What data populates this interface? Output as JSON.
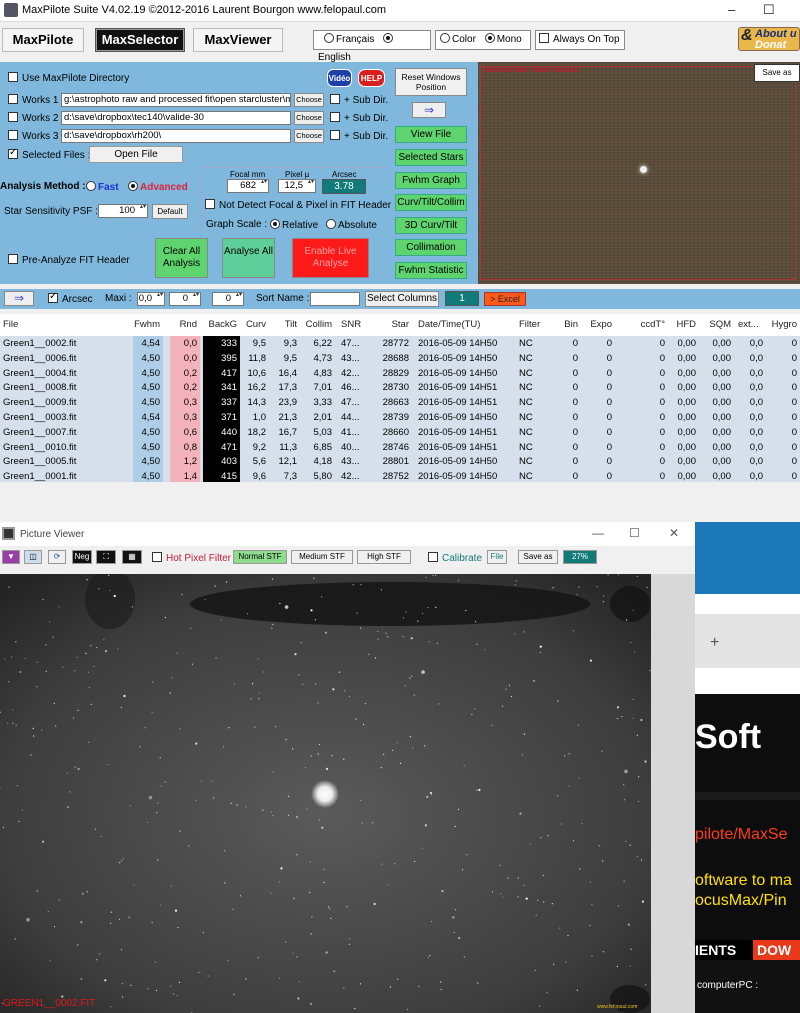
{
  "app": {
    "title": "MaxPilote Suite  V4.02.19  ©2012-2016 Laurent Bourgon  www.felopaul.com",
    "minimize": "–",
    "maximize": "☐"
  },
  "tabs": [
    {
      "label": "MaxPilote"
    },
    {
      "label": "MaxSelector"
    },
    {
      "label": "MaxViewer"
    }
  ],
  "language": {
    "fr": "Français",
    "en": "English",
    "selected": "English"
  },
  "colormode": {
    "color": "Color",
    "mono": "Mono",
    "selected": "Mono"
  },
  "always_on_top": "Always On Top",
  "about": {
    "line1": "About u",
    "line2": "Donat"
  },
  "panel": {
    "use_dir": "Use MaxPilote Directory",
    "video_btn": "Vidéo",
    "help_btn": "HELP",
    "reset_btn": "Reset Windows Position",
    "works": [
      {
        "label": "Works 1",
        "path": "g:\\astrophoto raw and processed fit\\open starcluster\\m"
      },
      {
        "label": "Works 2",
        "path": "d:\\save\\dropbox\\tec140\\valide-30"
      },
      {
        "label": "Works 3",
        "path": "d:\\save\\dropbox\\rh200\\"
      }
    ],
    "choose": "Choose",
    "subdir": "+ Sub Dir.",
    "selected_files": "Selected Files :",
    "open_file": "Open File",
    "view_file": "View File",
    "selected_stars": "Selected Stars",
    "fwhm_graph": "Fwhm Graph",
    "curv_tilt": "Curv/Tilt/Collim",
    "curv_3d": "3D Curv/Tilt",
    "collimation": "Collimation",
    "fwhm_stat": "Fwhm Statistic",
    "analysis_method": "Analysis Method :",
    "fast": "Fast",
    "advanced": "Advanced",
    "star_sens": "Star Sensitivity  PSF :",
    "psf_value": "100",
    "default_btn": "Default",
    "focal_lbl": "Focal mm",
    "pixel_lbl": "Pixel µ",
    "arcsec_lbl": "Arcsec",
    "focal_value": "682",
    "pixel_value": "12,5",
    "arcsec_value": "3.78",
    "not_detect": "Not Detect Focal & Pixel in FIT Header",
    "graph_scale": "Graph Scale :",
    "relative": "Relative",
    "absolute": "Absolute",
    "pre_analyze": "Pre-Analyze FIT Header",
    "clear_all": "Clear All Analysis",
    "analyse_all": "Analyse All",
    "live": "Enable Live Analyse"
  },
  "preview": {
    "caption": "Selected Stars Frame (Arcsec)",
    "save_as": "Save as"
  },
  "toolbar2": {
    "arcsec": "Arcsec",
    "maxi": "Maxi :",
    "v1": "0,0",
    "v2": "0",
    "v3": "0",
    "sort_name": "Sort Name :",
    "select_columns": "Select Columns",
    "count": "1",
    "excel": "> Excel"
  },
  "table": {
    "headers": [
      "File",
      "Fwhm",
      "Rnd",
      "BackG",
      "Curv",
      "Tilt",
      "Collim",
      "SNR",
      "Star",
      "Date/Time(TU)",
      "Filter",
      "Bin",
      "Expo",
      "ccdT°",
      "HFD",
      "SQM",
      "ext...",
      "Hygro"
    ],
    "rows": [
      [
        "Green1__0002.fit",
        "4,54",
        "0,0",
        "333",
        "9,5",
        "9,3",
        "6,22",
        "47...",
        "28772",
        "2016-05-09 14H50",
        "NC",
        "0",
        "0",
        "0",
        "0,00",
        "0,00",
        "0,0",
        "0"
      ],
      [
        "Green1__0006.fit",
        "4,50",
        "0,0",
        "395",
        "11,8",
        "9,5",
        "4,73",
        "43...",
        "28688",
        "2016-05-09 14H50",
        "NC",
        "0",
        "0",
        "0",
        "0,00",
        "0,00",
        "0,0",
        "0"
      ],
      [
        "Green1__0004.fit",
        "4,50",
        "0,2",
        "417",
        "10,6",
        "16,4",
        "4,83",
        "42...",
        "28829",
        "2016-05-09 14H50",
        "NC",
        "0",
        "0",
        "0",
        "0,00",
        "0,00",
        "0,0",
        "0"
      ],
      [
        "Green1__0008.fit",
        "4,50",
        "0,2",
        "341",
        "16,2",
        "17,3",
        "7,01",
        "46...",
        "28730",
        "2016-05-09 14H51",
        "NC",
        "0",
        "0",
        "0",
        "0,00",
        "0,00",
        "0,0",
        "0"
      ],
      [
        "Green1__0009.fit",
        "4,50",
        "0,3",
        "337",
        "14,3",
        "23,9",
        "3,33",
        "47...",
        "28663",
        "2016-05-09 14H51",
        "NC",
        "0",
        "0",
        "0",
        "0,00",
        "0,00",
        "0,0",
        "0"
      ],
      [
        "Green1__0003.fit",
        "4,54",
        "0,3",
        "371",
        "1,0",
        "21,3",
        "2,01",
        "44...",
        "28739",
        "2016-05-09 14H50",
        "NC",
        "0",
        "0",
        "0",
        "0,00",
        "0,00",
        "0,0",
        "0"
      ],
      [
        "Green1__0007.fit",
        "4,50",
        "0,6",
        "440",
        "18,2",
        "16,7",
        "5,03",
        "41...",
        "28660",
        "2016-05-09 14H51",
        "NC",
        "0",
        "0",
        "0",
        "0,00",
        "0,00",
        "0,0",
        "0"
      ],
      [
        "Green1__0010.fit",
        "4,50",
        "0,8",
        "471",
        "9,2",
        "11,3",
        "6,85",
        "40...",
        "28746",
        "2016-05-09 14H51",
        "NC",
        "0",
        "0",
        "0",
        "0,00",
        "0,00",
        "0,0",
        "0"
      ],
      [
        "Green1__0005.fit",
        "4,50",
        "1,2",
        "403",
        "5,6",
        "12,1",
        "4,18",
        "43...",
        "28801",
        "2016-05-09 14H50",
        "NC",
        "0",
        "0",
        "0",
        "0,00",
        "0,00",
        "0,0",
        "0"
      ],
      [
        "Green1__0001.fit",
        "4,50",
        "1,4",
        "415",
        "9,6",
        "7,3",
        "5,80",
        "42...",
        "28752",
        "2016-05-09 14H50",
        "NC",
        "0",
        "0",
        "0",
        "0,00",
        "0,00",
        "0,0",
        "0"
      ]
    ]
  },
  "viewer": {
    "title": "Picture Viewer",
    "neg": "Neg",
    "hot_pixel": "Hot Pixel Filter",
    "normal_stf": "Normal STF",
    "medium_stf": "Medium STF",
    "high_stf": "High STF",
    "calibrate": "Calibrate",
    "file": "File",
    "save_as": "Save as",
    "zoom": "27%",
    "image_label": "GREEN1__0002.FIT",
    "watermark": "www.felopaul.com",
    "min": "—",
    "max": "☐",
    "close": "✕"
  },
  "browser": {
    "plus": "+",
    "soft": "Soft",
    "line1": "pilote/MaxSe",
    "line2": "oftware to ma",
    "line3": "ocusMax/Pin",
    "nav1": "IENTS",
    "nav2": "DOW",
    "foot": "computerPC :"
  }
}
